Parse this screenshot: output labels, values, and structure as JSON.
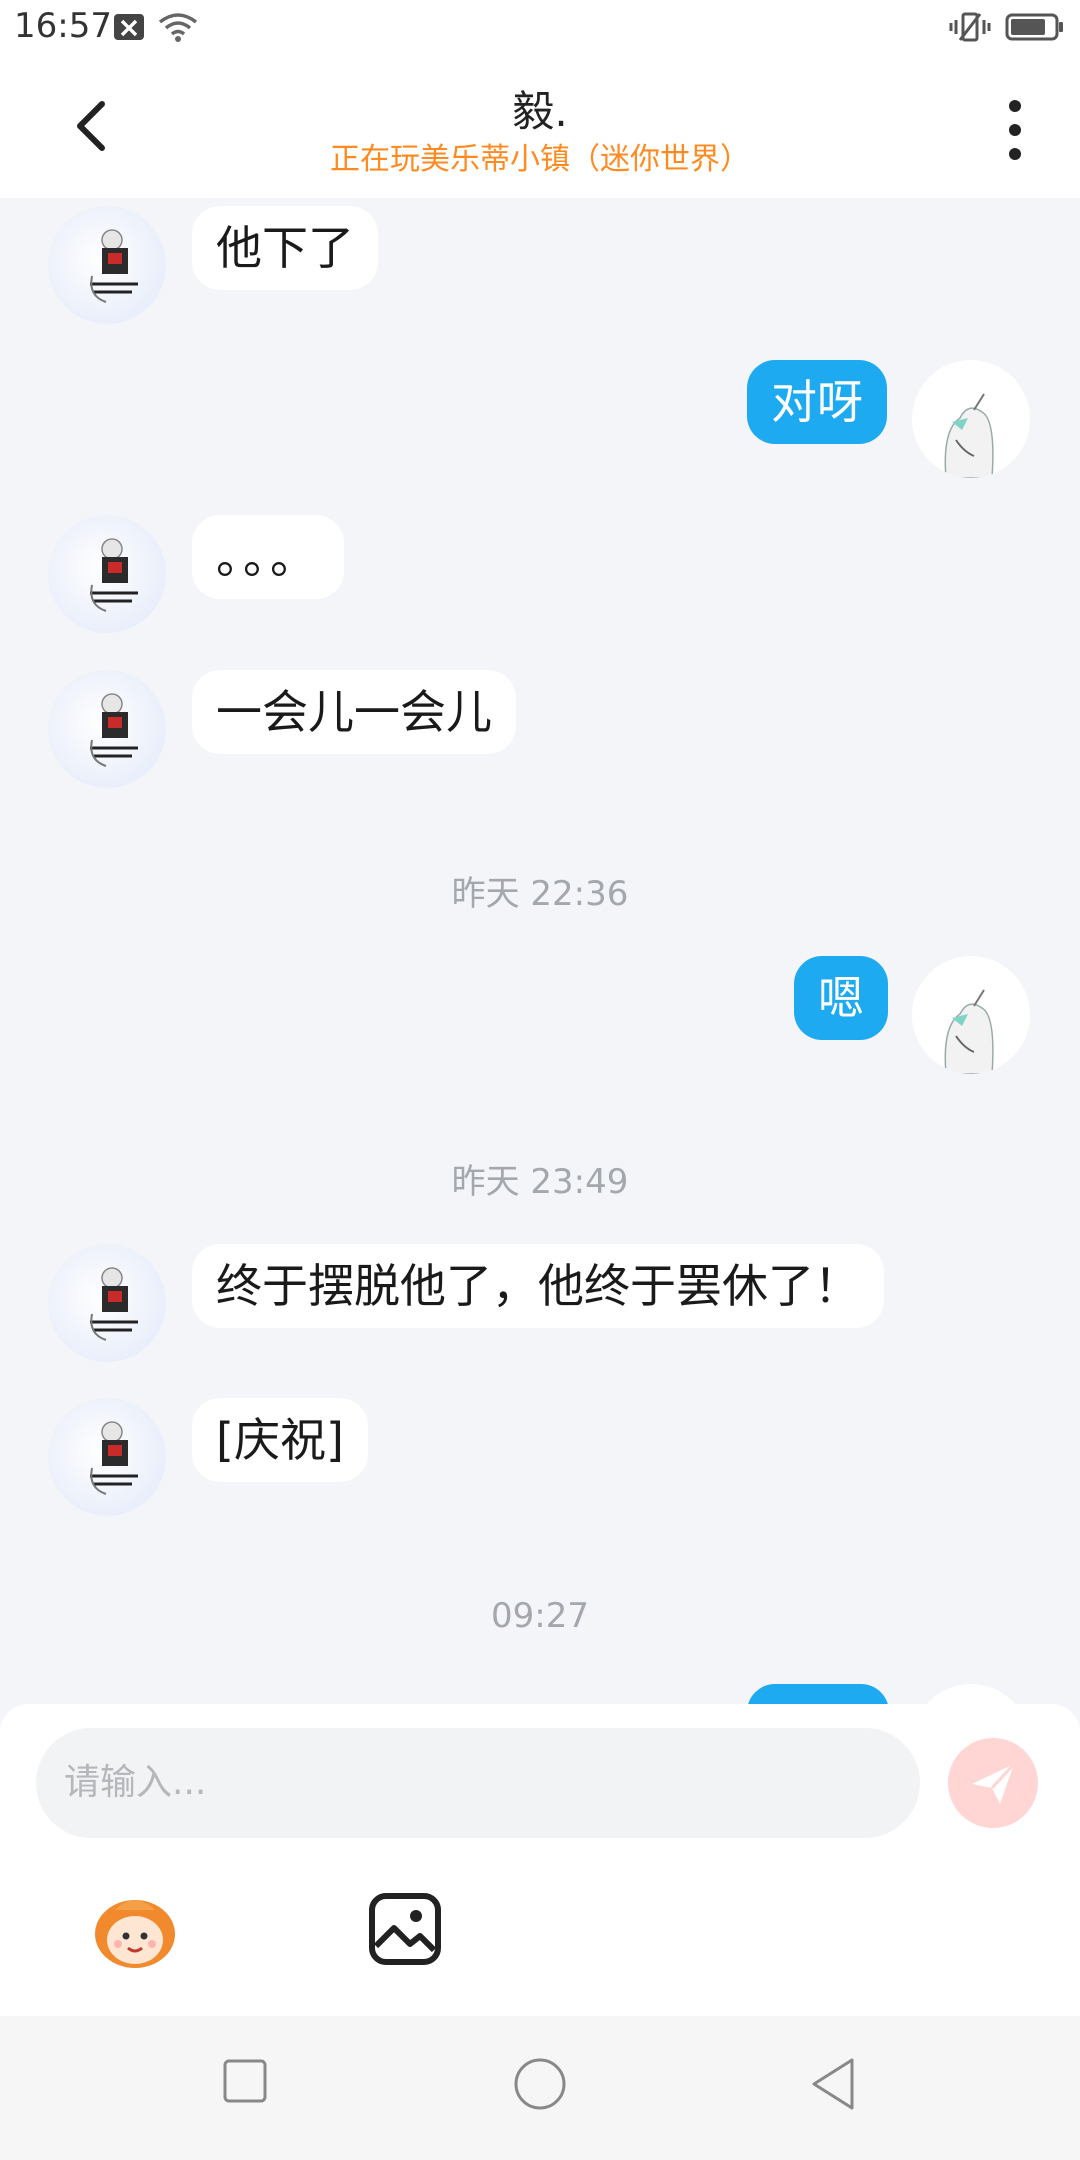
{
  "status_bar": {
    "time": "16:57"
  },
  "header": {
    "title": "毅.",
    "subtitle": "正在玩美乐蒂小镇（迷你世界）"
  },
  "messages": [
    {
      "from": "peer",
      "text": "他下了"
    },
    {
      "from": "me",
      "text": "对呀"
    },
    {
      "from": "peer",
      "text": "。。。"
    },
    {
      "from": "peer",
      "text": "一会儿一会儿"
    },
    {
      "time": "昨天 22:36"
    },
    {
      "from": "me",
      "text": "嗯"
    },
    {
      "time": "昨天 23:49"
    },
    {
      "from": "peer",
      "text": "终于摆脱他了，他终于罢休了！"
    },
    {
      "from": "peer",
      "text": "[庆祝]"
    },
    {
      "time": "09:27"
    }
  ],
  "composer": {
    "placeholder": "请输入...",
    "tools": [
      "emoji-icon",
      "image-icon"
    ]
  },
  "colors": {
    "accent": "#1eaaf1",
    "subtitle": "#ff8a1f",
    "send_disabled": "#ffd6d3"
  }
}
